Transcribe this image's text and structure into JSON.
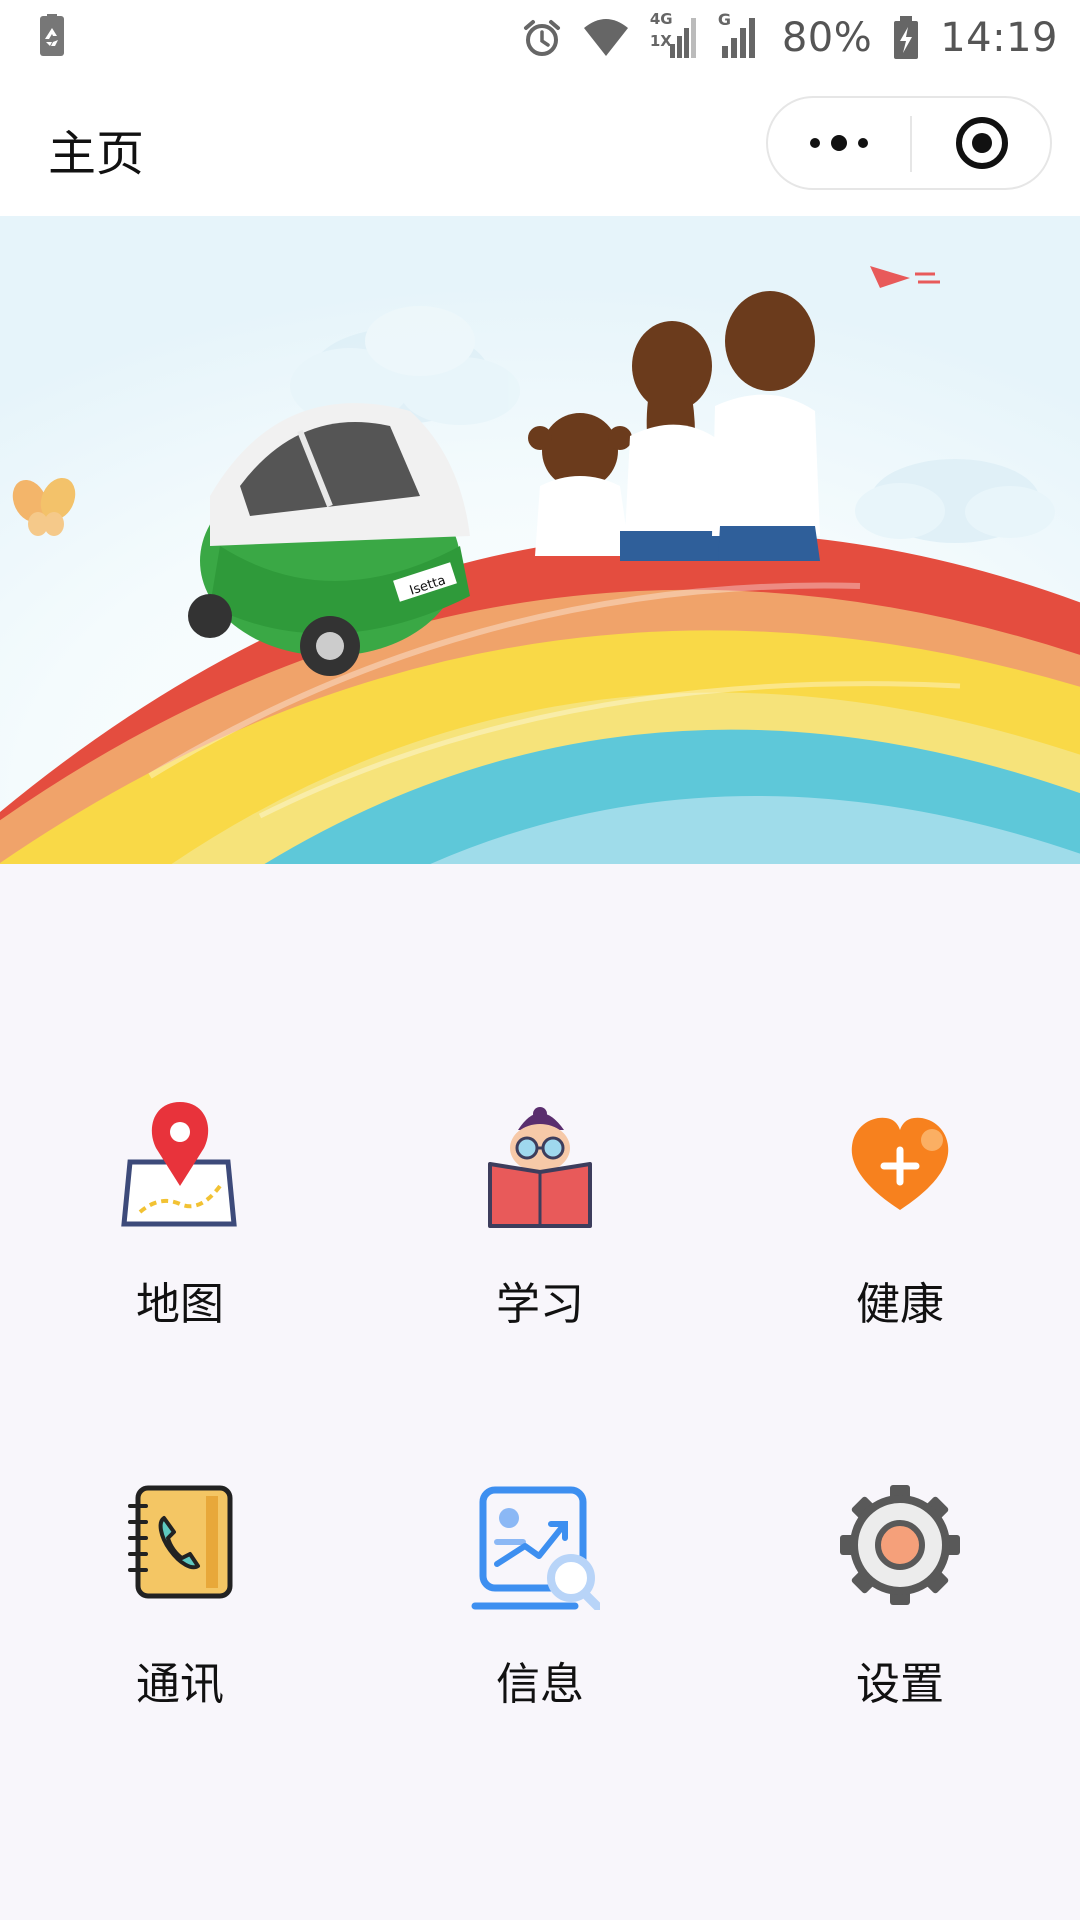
{
  "status_bar": {
    "battery_percent": "80%",
    "time": "14:19",
    "network_4g": "4G",
    "network_1x": "1X",
    "network_g": "G",
    "icons": [
      "recycle-icon",
      "alarm-icon",
      "wifi-icon",
      "signal-icon",
      "signal-icon",
      "battery-charging-icon"
    ]
  },
  "nav_bar": {
    "title": "主页",
    "more_icon": "more-dots-icon",
    "close_icon": "target-circle-icon"
  },
  "banner": {
    "car_plate": "Isetta",
    "colors": {
      "sky": "#eaf6fb",
      "rainbow_red": "#e4483c",
      "rainbow_orange": "#f4a86a",
      "rainbow_yellow": "#f9d847",
      "rainbow_blue": "#5ec8d9",
      "car_green": "#39b54a"
    }
  },
  "grid": {
    "items": [
      {
        "label": "地图",
        "icon": "map-pin-icon"
      },
      {
        "label": "学习",
        "icon": "reading-student-icon"
      },
      {
        "label": "健康",
        "icon": "heart-plus-icon"
      },
      {
        "label": "通讯",
        "icon": "phone-book-icon"
      },
      {
        "label": "信息",
        "icon": "info-search-icon"
      },
      {
        "label": "设置",
        "icon": "gear-icon"
      }
    ]
  },
  "colors": {
    "background": "#f8f6fb",
    "text": "#111111",
    "status_text": "#555555",
    "heart_orange": "#f7811e",
    "info_blue": "#3d8ff0"
  }
}
